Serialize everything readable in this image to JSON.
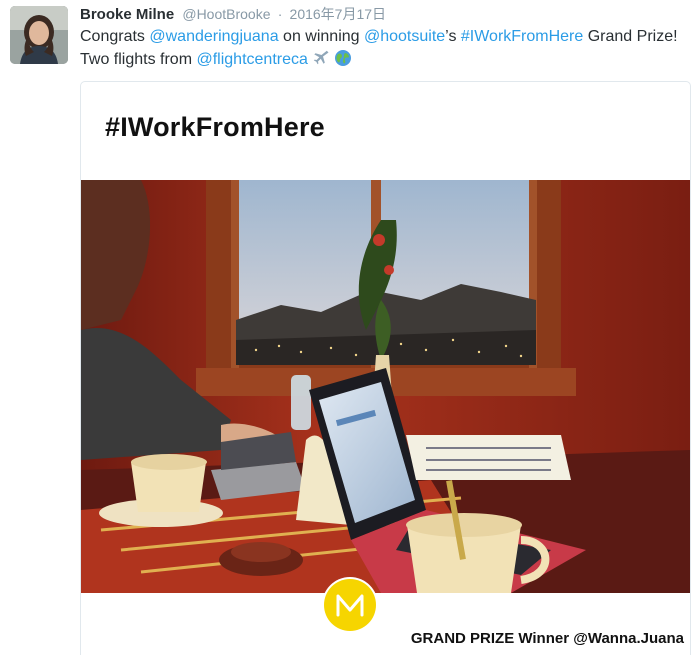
{
  "tweet": {
    "author": {
      "fullname": "Brooke Milne",
      "username": "@HootBrooke",
      "separator": "·",
      "timestamp": "2016年7月17日"
    },
    "text": {
      "part1": "Congrats ",
      "mention1": "@wanderingjuana",
      "part2": " on winning ",
      "mention2": "@hootsuite",
      "part3": "’s ",
      "hashtag": "#IWorkFromHere",
      "part4": " Grand Prize! Two flights from ",
      "mention3": "@flightcentreca",
      "emoji1": "airplane-emoji",
      "emoji2": "globe-emoji"
    },
    "card": {
      "title": "#IWorkFromHere",
      "caption": "GRAND PRIZE Winner @Wanna.Juana",
      "badge_letter": "M"
    }
  },
  "colors": {
    "link": "#2b9ce6",
    "secondary": "#8899a6",
    "badge": "#f6d500",
    "border": "#e1e8ed"
  }
}
